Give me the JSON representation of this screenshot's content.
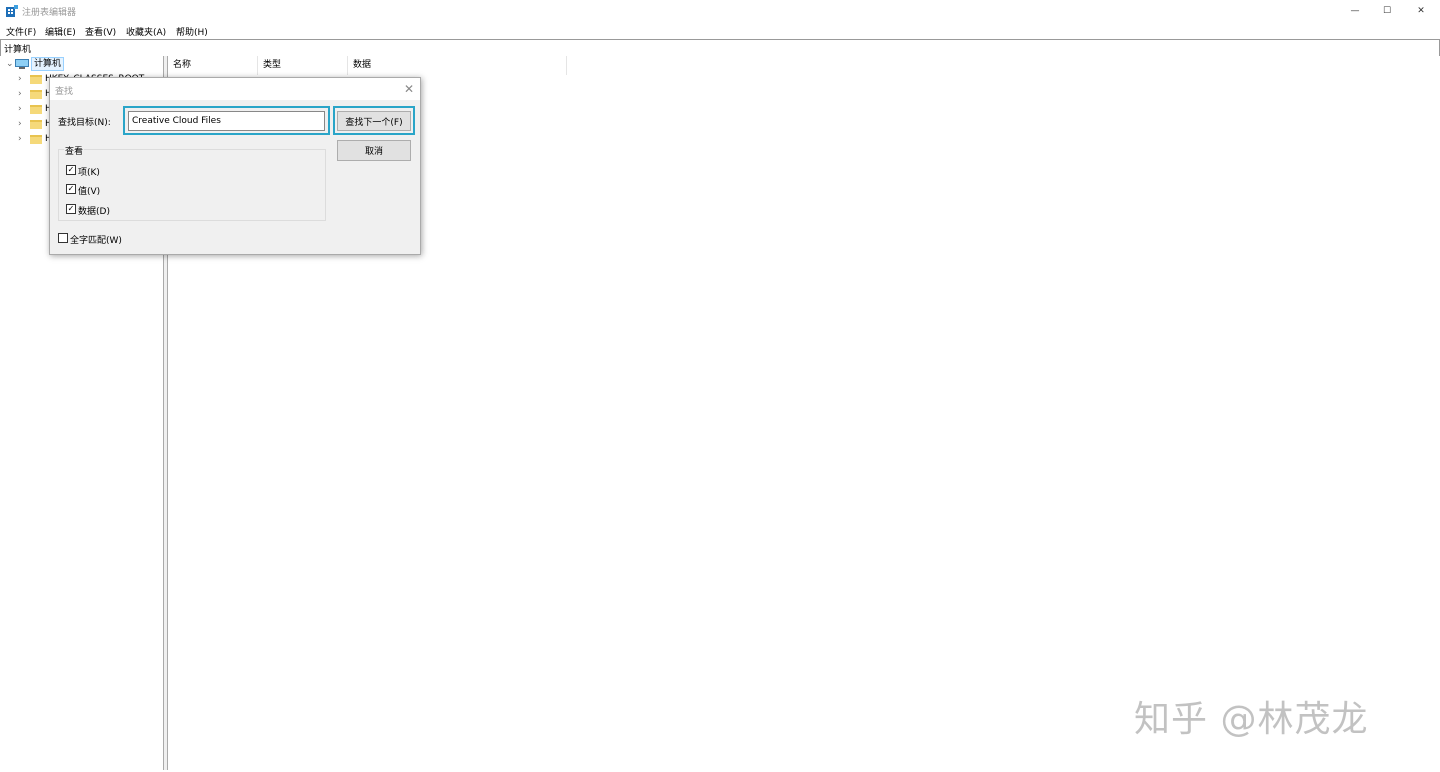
{
  "window": {
    "title": "注册表编辑器",
    "minimize_glyph": "—",
    "maximize_glyph": "☐",
    "close_glyph": "✕"
  },
  "menu": {
    "file": "文件(F)",
    "edit": "编辑(E)",
    "view": "查看(V)",
    "favorites": "收藏夹(A)",
    "help": "帮助(H)"
  },
  "address": {
    "path": "计算机"
  },
  "tree": {
    "root_label": "计算机",
    "items": [
      {
        "label": "HKEY_CLASSES_ROOT"
      },
      {
        "label": "H"
      },
      {
        "label": "H"
      },
      {
        "label": "H"
      },
      {
        "label": "H"
      }
    ]
  },
  "list": {
    "columns": [
      "名称",
      "类型",
      "数据"
    ]
  },
  "find_dialog": {
    "title": "查找",
    "close_glyph": "✕",
    "target_label": "查找目标(N):",
    "target_value": "Creative Cloud Files",
    "find_next_label": "查找下一个(F)",
    "cancel_label": "取消",
    "look_at_label": "查看",
    "options": [
      {
        "label": "项(K)",
        "checked": true
      },
      {
        "label": "值(V)",
        "checked": true
      },
      {
        "label": "数据(D)",
        "checked": true
      }
    ],
    "match_whole": {
      "label": "全字匹配(W)",
      "checked": false
    },
    "check_glyph": "✓"
  },
  "watermark": "知乎 @林茂龙",
  "colors": {
    "focus": "#2aa5c8",
    "folder": "#f5d97a",
    "dialog_bg": "#f0f0f0"
  }
}
